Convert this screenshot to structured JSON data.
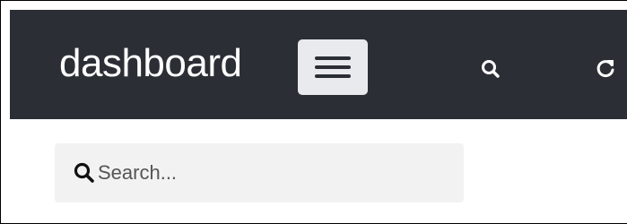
{
  "navbar": {
    "brand": "dashboard",
    "menu_toggle_icon": "hamburger-icon",
    "search_icon": "search-icon",
    "refresh_icon": "refresh-icon",
    "background_color": "#2b2f35",
    "toggle_color": "#e8eaed"
  },
  "search": {
    "placeholder": "Search...",
    "value": "",
    "icon": "search-icon",
    "background_color": "#f2f2f2"
  }
}
